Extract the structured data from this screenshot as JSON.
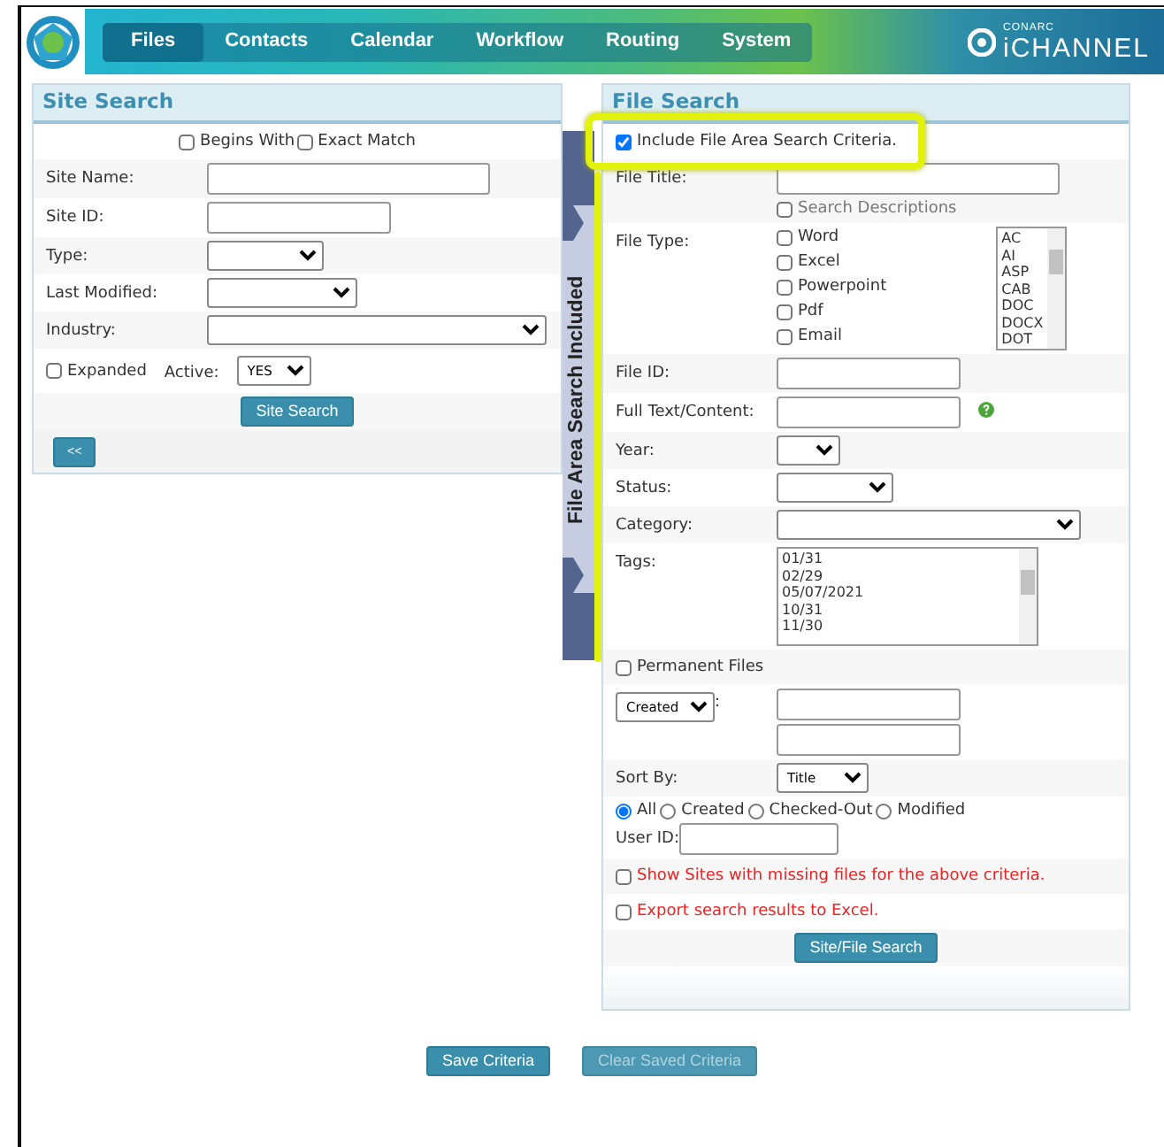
{
  "header": {
    "tabs": [
      {
        "label": "Files",
        "selected": true
      },
      {
        "label": "Contacts",
        "selected": false
      },
      {
        "label": "Calendar",
        "selected": false
      },
      {
        "label": "Workflow",
        "selected": false
      },
      {
        "label": "Routing",
        "selected": false
      },
      {
        "label": "System",
        "selected": false
      }
    ],
    "brand": {
      "top": "CONARC",
      "bottom": "iCHANNEL"
    }
  },
  "site_search": {
    "title": "Site Search",
    "rows": [
      {
        "kind": "options",
        "controls": [
          {
            "kind": "checkbox",
            "label": "Begins With",
            "checked": false
          },
          {
            "kind": "checkbox",
            "label": "Exact Match",
            "checked": false
          }
        ]
      },
      {
        "kind": "field",
        "label": "Site Name:",
        "controls": [
          {
            "kind": "text"
          }
        ]
      },
      {
        "kind": "field",
        "label": "Site ID:",
        "controls": [
          {
            "kind": "text"
          }
        ]
      },
      {
        "kind": "field",
        "label": "Type:",
        "controls": [
          {
            "kind": "select"
          }
        ]
      },
      {
        "kind": "field",
        "label": "Last Modified:",
        "controls": [
          {
            "kind": "select"
          }
        ]
      },
      {
        "kind": "field",
        "label": "Industry:",
        "controls": [
          {
            "kind": "select"
          }
        ]
      },
      {
        "kind": "options",
        "controls": [
          {
            "kind": "checkbox",
            "label": "Expanded",
            "checked": false
          },
          {
            "kind": "label",
            "text": "Active:"
          },
          {
            "kind": "select",
            "value": "YES"
          }
        ]
      },
      {
        "kind": "action",
        "controls": [
          {
            "kind": "button",
            "label": "Site Search",
            "disabled": false
          }
        ]
      }
    ],
    "collapse": "<<"
  },
  "side_tab": {
    "label": "File Area Search Included"
  },
  "file_search": {
    "title": "File Search",
    "rows": [
      {
        "kind": "options",
        "highlighted": true,
        "controls": [
          {
            "kind": "checkbox",
            "label": "Include File Area Search Criteria.",
            "checked": true
          }
        ]
      },
      {
        "kind": "field",
        "label": "File Title:",
        "controls": [
          {
            "kind": "stack",
            "controls": [
              {
                "kind": "text"
              },
              {
                "kind": "checkbox",
                "label": "Search Descriptions",
                "checked": false,
                "disabled": true
              }
            ]
          }
        ]
      },
      {
        "kind": "field",
        "label": "File Type:",
        "controls": [
          {
            "kind": "stack",
            "controls": [
              {
                "kind": "checkbox",
                "label": "Word",
                "checked": false
              },
              {
                "kind": "checkbox",
                "label": "Excel",
                "checked": false
              },
              {
                "kind": "checkbox",
                "label": "Powerpoint",
                "checked": false
              },
              {
                "kind": "checkbox",
                "label": "Pdf",
                "checked": false
              },
              {
                "kind": "checkbox",
                "label": "Email",
                "checked": false
              }
            ]
          },
          {
            "kind": "listbox",
            "items": [
              "AC",
              "AI",
              "ASP",
              "CAB",
              "DOC",
              "DOCX",
              "DOT"
            ]
          }
        ]
      },
      {
        "kind": "field",
        "label": "File ID:",
        "controls": [
          {
            "kind": "text"
          }
        ]
      },
      {
        "kind": "field",
        "label": "Full Text/Content:",
        "controls": [
          {
            "kind": "text"
          },
          {
            "kind": "help"
          }
        ]
      },
      {
        "kind": "field",
        "label": "Year:",
        "controls": [
          {
            "kind": "select"
          }
        ]
      },
      {
        "kind": "field",
        "label": "Status:",
        "controls": [
          {
            "kind": "select"
          }
        ]
      },
      {
        "kind": "field",
        "label": "Category:",
        "controls": [
          {
            "kind": "select"
          }
        ]
      },
      {
        "kind": "field",
        "label": "Tags:",
        "controls": [
          {
            "kind": "listbox",
            "items": [
              "01/31",
              "02/29",
              "05/07/2021",
              "10/31",
              "11/30"
            ]
          }
        ]
      },
      {
        "kind": "options",
        "controls": [
          {
            "kind": "checkbox",
            "label": "Permanent Files",
            "checked": false
          }
        ]
      },
      {
        "kind": "field",
        "label_select": {
          "value": "Created",
          "suffix": ":"
        },
        "controls": [
          {
            "kind": "stack",
            "controls": [
              {
                "kind": "text"
              },
              {
                "kind": "text"
              }
            ]
          }
        ]
      },
      {
        "kind": "field",
        "label": "Sort By:",
        "controls": [
          {
            "kind": "select",
            "value": "Title"
          }
        ]
      },
      {
        "kind": "radios",
        "controls": [
          {
            "kind": "radio",
            "label": "All",
            "selected": true
          },
          {
            "kind": "radio",
            "label": "Created",
            "selected": false
          },
          {
            "kind": "radio",
            "label": "Checked-Out",
            "selected": false
          },
          {
            "kind": "radio",
            "label": "Modified",
            "selected": false
          }
        ],
        "user_field": {
          "label": "User ID:"
        }
      },
      {
        "kind": "options",
        "controls": [
          {
            "kind": "warning-checkbox",
            "label": "Show Sites with missing files for the above criteria.",
            "checked": false
          }
        ]
      },
      {
        "kind": "options",
        "controls": [
          {
            "kind": "warning-checkbox",
            "label": "Export search results to Excel.",
            "checked": false
          }
        ]
      },
      {
        "kind": "action",
        "controls": [
          {
            "kind": "button",
            "label": "Site/File Search",
            "disabled": false
          }
        ]
      }
    ]
  },
  "footer": {
    "buttons": [
      {
        "label": "Save Criteria",
        "disabled": false
      },
      {
        "label": "Clear Saved Criteria",
        "disabled": true
      }
    ]
  }
}
